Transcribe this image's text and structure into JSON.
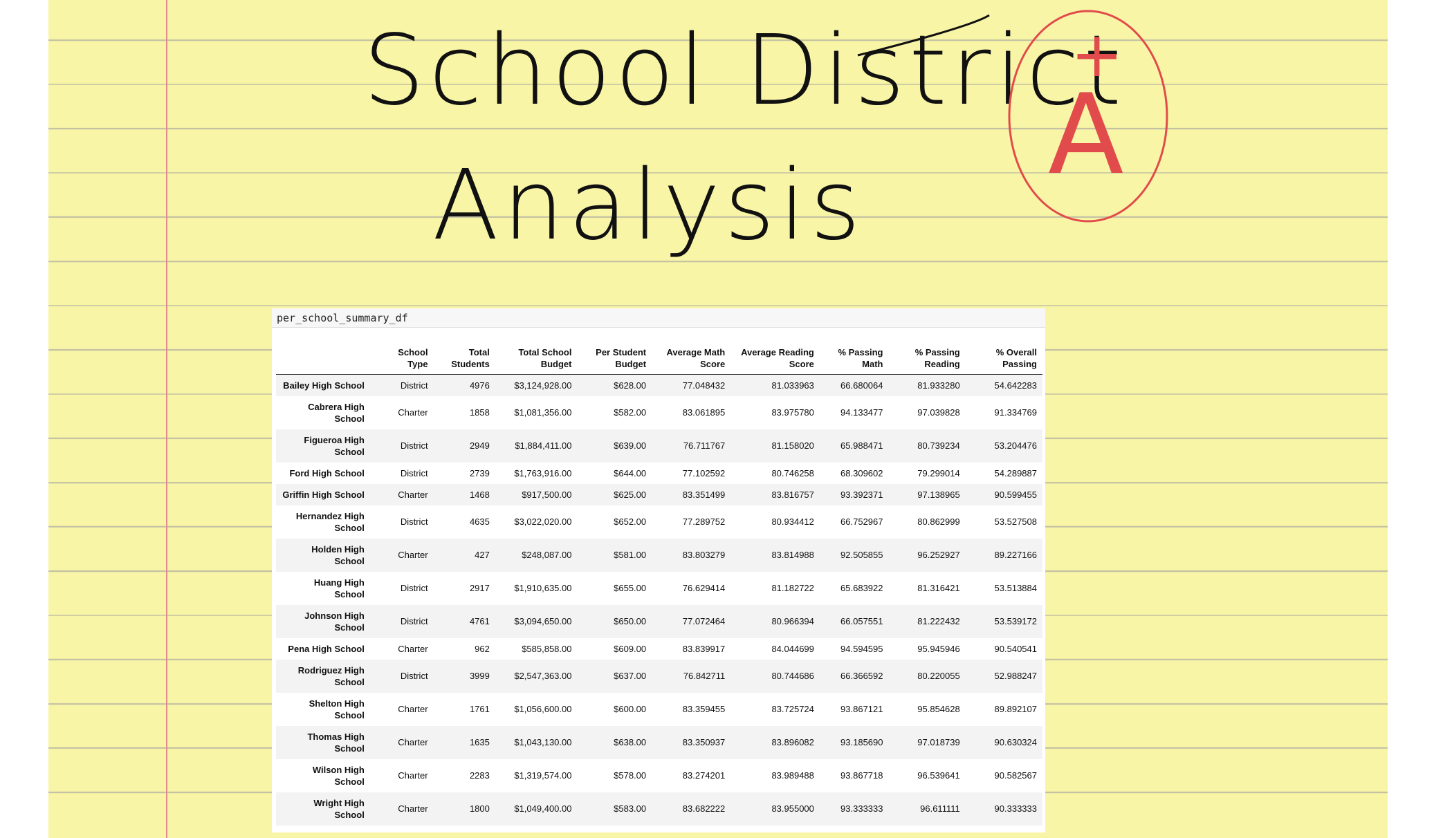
{
  "heading": {
    "line1": "School District",
    "line2": "Analysis"
  },
  "grade": {
    "text": "A",
    "superscript": "+",
    "color": "#e14b4b"
  },
  "colors": {
    "paper": "#f9f5a6",
    "rule_line": "#c4c1a4",
    "margin_line": "#e58a8a",
    "ink": "#111111"
  },
  "cell_label": "per_school_summary_df",
  "table": {
    "columns": [
      "School Type",
      "Total Students",
      "Total School Budget",
      "Per Student Budget",
      "Average Math Score",
      "Average Reading Score",
      "% Passing Math",
      "% Passing Reading",
      "% Overall Passing"
    ],
    "rows": [
      {
        "school": "Bailey High School",
        "cells": [
          "District",
          "4976",
          "$3,124,928.00",
          "$628.00",
          "77.048432",
          "81.033963",
          "66.680064",
          "81.933280",
          "54.642283"
        ]
      },
      {
        "school": "Cabrera High School",
        "cells": [
          "Charter",
          "1858",
          "$1,081,356.00",
          "$582.00",
          "83.061895",
          "83.975780",
          "94.133477",
          "97.039828",
          "91.334769"
        ]
      },
      {
        "school": "Figueroa High School",
        "cells": [
          "District",
          "2949",
          "$1,884,411.00",
          "$639.00",
          "76.711767",
          "81.158020",
          "65.988471",
          "80.739234",
          "53.204476"
        ]
      },
      {
        "school": "Ford High School",
        "cells": [
          "District",
          "2739",
          "$1,763,916.00",
          "$644.00",
          "77.102592",
          "80.746258",
          "68.309602",
          "79.299014",
          "54.289887"
        ]
      },
      {
        "school": "Griffin High School",
        "cells": [
          "Charter",
          "1468",
          "$917,500.00",
          "$625.00",
          "83.351499",
          "83.816757",
          "93.392371",
          "97.138965",
          "90.599455"
        ]
      },
      {
        "school": "Hernandez High School",
        "cells": [
          "District",
          "4635",
          "$3,022,020.00",
          "$652.00",
          "77.289752",
          "80.934412",
          "66.752967",
          "80.862999",
          "53.527508"
        ]
      },
      {
        "school": "Holden High School",
        "cells": [
          "Charter",
          "427",
          "$248,087.00",
          "$581.00",
          "83.803279",
          "83.814988",
          "92.505855",
          "96.252927",
          "89.227166"
        ]
      },
      {
        "school": "Huang High School",
        "cells": [
          "District",
          "2917",
          "$1,910,635.00",
          "$655.00",
          "76.629414",
          "81.182722",
          "65.683922",
          "81.316421",
          "53.513884"
        ]
      },
      {
        "school": "Johnson High School",
        "cells": [
          "District",
          "4761",
          "$3,094,650.00",
          "$650.00",
          "77.072464",
          "80.966394",
          "66.057551",
          "81.222432",
          "53.539172"
        ]
      },
      {
        "school": "Pena High School",
        "cells": [
          "Charter",
          "962",
          "$585,858.00",
          "$609.00",
          "83.839917",
          "84.044699",
          "94.594595",
          "95.945946",
          "90.540541"
        ]
      },
      {
        "school": "Rodriguez High School",
        "cells": [
          "District",
          "3999",
          "$2,547,363.00",
          "$637.00",
          "76.842711",
          "80.744686",
          "66.366592",
          "80.220055",
          "52.988247"
        ]
      },
      {
        "school": "Shelton High School",
        "cells": [
          "Charter",
          "1761",
          "$1,056,600.00",
          "$600.00",
          "83.359455",
          "83.725724",
          "93.867121",
          "95.854628",
          "89.892107"
        ]
      },
      {
        "school": "Thomas High School",
        "cells": [
          "Charter",
          "1635",
          "$1,043,130.00",
          "$638.00",
          "83.350937",
          "83.896082",
          "93.185690",
          "97.018739",
          "90.630324"
        ]
      },
      {
        "school": "Wilson High School",
        "cells": [
          "Charter",
          "2283",
          "$1,319,574.00",
          "$578.00",
          "83.274201",
          "83.989488",
          "93.867718",
          "96.539641",
          "90.582567"
        ]
      },
      {
        "school": "Wright High School",
        "cells": [
          "Charter",
          "1800",
          "$1,049,400.00",
          "$583.00",
          "83.682222",
          "83.955000",
          "93.333333",
          "96.611111",
          "90.333333"
        ]
      }
    ]
  }
}
